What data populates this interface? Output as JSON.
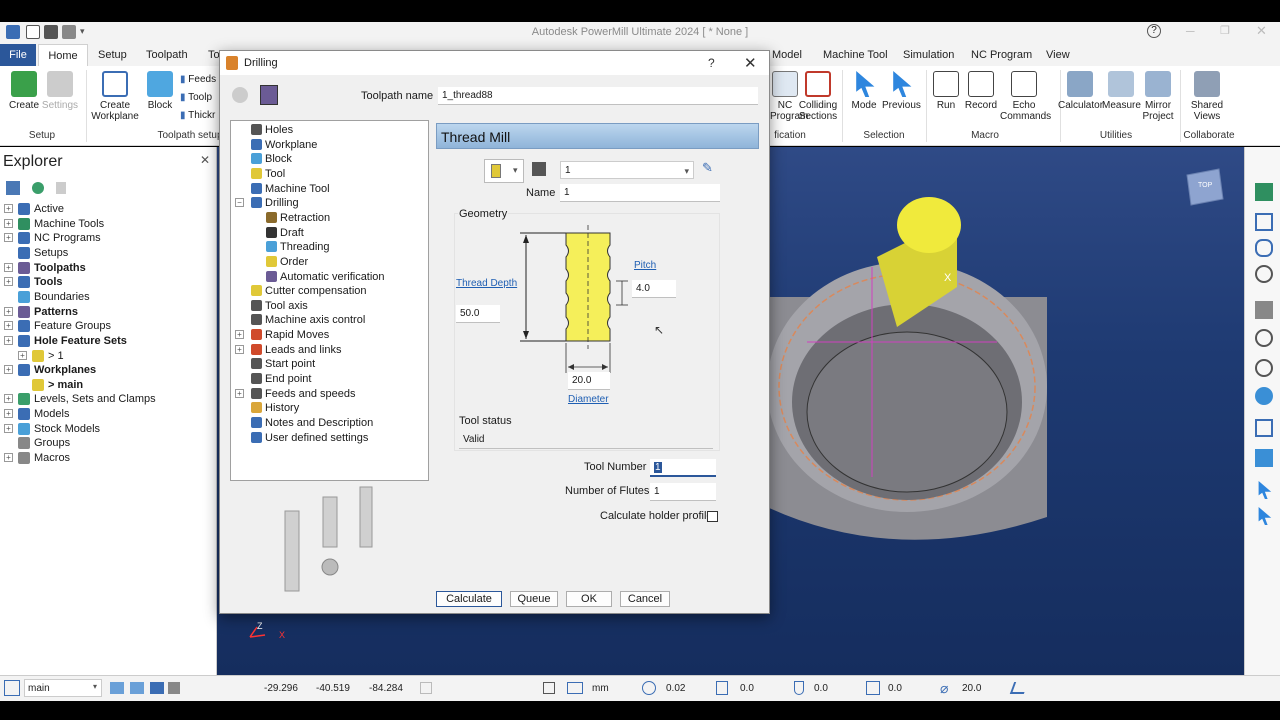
{
  "app": {
    "title": "Autodesk PowerMill Ultimate 2024    [ * None ]",
    "help_icon": "?"
  },
  "tabs": [
    "File",
    "Home",
    "Setup",
    "Toolpath",
    "To",
    "Model",
    "Machine Tool",
    "Simulation",
    "NC Program",
    "View"
  ],
  "ribbon": {
    "create": "Create",
    "settings": "Settings",
    "create_workplane": "Create Workplane",
    "block": "Block",
    "feeds": "Feeds",
    "toolp": "Toolp",
    "thick": "Thickr",
    "group_setup": "Setup",
    "group_toolpath_setup": "Toolpath setup",
    "nc_program": "NC Program",
    "colliding_sections": "Colliding Sections",
    "group_verification": "fication",
    "mode": "Mode",
    "previous": "Previous",
    "group_selection": "Selection",
    "run": "Run",
    "record": "Record",
    "echo_commands": "Echo Commands",
    "group_macro": "Macro",
    "calculator": "Calculator",
    "measure": "Measure",
    "mirror_project": "Mirror Project",
    "group_utilities": "Utilities",
    "shared_views": "Shared Views",
    "group_collaborate": "Collaborate"
  },
  "explorer": {
    "title": "Explorer",
    "close": "✕",
    "items": [
      {
        "label": "Active",
        "bold": false
      },
      {
        "label": "Machine Tools",
        "bold": false
      },
      {
        "label": "NC Programs",
        "bold": false
      },
      {
        "label": "Setups",
        "bold": false
      },
      {
        "label": "Toolpaths",
        "bold": true
      },
      {
        "label": "Tools",
        "bold": true
      },
      {
        "label": "Boundaries",
        "bold": false
      },
      {
        "label": "Patterns",
        "bold": true
      },
      {
        "label": "Feature Groups",
        "bold": false
      },
      {
        "label": "Hole Feature Sets",
        "bold": true
      },
      {
        "label": "> 1",
        "bold": false
      },
      {
        "label": "Workplanes",
        "bold": true
      },
      {
        "label": "> main",
        "bold": true
      },
      {
        "label": "Levels, Sets and Clamps",
        "bold": false
      },
      {
        "label": "Models",
        "bold": false
      },
      {
        "label": "Stock Models",
        "bold": false
      },
      {
        "label": "Groups",
        "bold": false
      },
      {
        "label": "Macros",
        "bold": false
      }
    ]
  },
  "dialog": {
    "title": "Drilling",
    "help": "?",
    "close": "✕",
    "toolpath_name_label": "Toolpath name",
    "toolpath_name": "1_thread88",
    "tree": [
      "Holes",
      "Workplane",
      "Block",
      "Tool",
      "Machine Tool",
      "Drilling",
      "Retraction",
      "Draft",
      "Threading",
      "Order",
      "Automatic verification",
      "Cutter compensation",
      "Tool axis",
      "Machine axis control",
      "Rapid Moves",
      "Leads and links",
      "Start point",
      "End point",
      "Feeds and speeds",
      "History",
      "Notes and Description",
      "User defined settings"
    ],
    "page_title": "Thread Mill",
    "tool_select": "1",
    "name_label": "Name",
    "name_value": "1",
    "geometry_label": "Geometry",
    "pitch_label": "Pitch",
    "pitch_value": "4.0",
    "thread_depth_label": "Thread Depth",
    "thread_depth_value": "50.0",
    "diameter_value": "20.0",
    "diameter_label": "Diameter",
    "tool_status_label": "Tool status",
    "tool_status_value": "Valid",
    "tool_number_label": "Tool Number",
    "tool_number_value": "1",
    "flutes_label": "Number of Flutes",
    "flutes_value": "1",
    "holder_label": "Calculate holder profile",
    "btn_calculate": "Calculate",
    "btn_queue": "Queue",
    "btn_ok": "OK",
    "btn_cancel": "Cancel"
  },
  "viewport": {
    "cube_label": "TOP",
    "axis_z": "Z",
    "axis_x": "X",
    "tool_marker": "X"
  },
  "status": {
    "workplane": "main",
    "x": "-29.296",
    "y": "-40.519",
    "z": "-84.284",
    "units": "mm",
    "tol": "0.02",
    "v1": "0.0",
    "v2": "0.0",
    "v3": "0.0",
    "dia": "20.0"
  },
  "colors": {
    "accent": "#2b579a",
    "tool_yellow": "#f0ea3c",
    "viewport_top": "#2f4a86"
  }
}
